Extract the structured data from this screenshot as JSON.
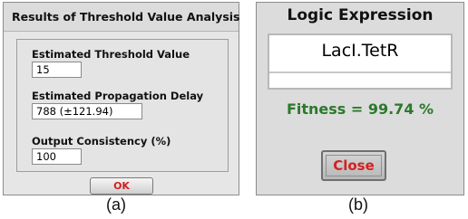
{
  "panel_a": {
    "title": "Results of Threshold Value Analysis",
    "fields": [
      {
        "label": "Estimated Threshold Value",
        "value": "15"
      },
      {
        "label": "Estimated Propagation Delay",
        "value": "788 (±121.94)"
      },
      {
        "label": "Output Consistency (%)",
        "value": "100"
      }
    ],
    "ok_label": "OK",
    "caption": "(a)"
  },
  "panel_b": {
    "title": "Logic Expression",
    "expression": "LacI.TetR",
    "fitness": "Fitness = 99.74 %",
    "close_label": "Close",
    "caption": "(b)"
  },
  "colors": {
    "button_text": "#d62020",
    "fitness_text": "#2a7a2a",
    "dialog_background": "#e6e6e6"
  }
}
